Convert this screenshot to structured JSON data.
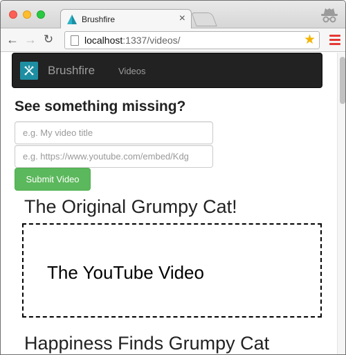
{
  "browser": {
    "tab_title": "Brushfire",
    "tab_close": "×",
    "url_host": "localhost",
    "url_path": ":1337/videos/",
    "icons": {
      "back": "arrow-left-icon",
      "forward": "arrow-right-icon",
      "reload": "reload-icon",
      "bookmark": "star-icon",
      "menu": "hamburger-menu-icon",
      "incognito": "incognito-icon"
    },
    "colors": {
      "star": "#f4b400",
      "menu": "#e53935"
    }
  },
  "navbar": {
    "brand": "Brushfire",
    "links": [
      {
        "label": "Videos"
      }
    ],
    "colors": {
      "background": "#222222",
      "logo": "#1e8fa3"
    }
  },
  "form": {
    "heading": "See something missing?",
    "title_placeholder": "e.g. My video title",
    "url_placeholder": "e.g. https://www.youtube.com/embed/Kdg",
    "submit_label": "Submit Video",
    "colors": {
      "submit": "#5cb85c"
    }
  },
  "videos": [
    {
      "title": "The Original Grumpy Cat!",
      "placeholder_label": "The YouTube Video"
    },
    {
      "title": "Happiness Finds Grumpy Cat"
    }
  ]
}
